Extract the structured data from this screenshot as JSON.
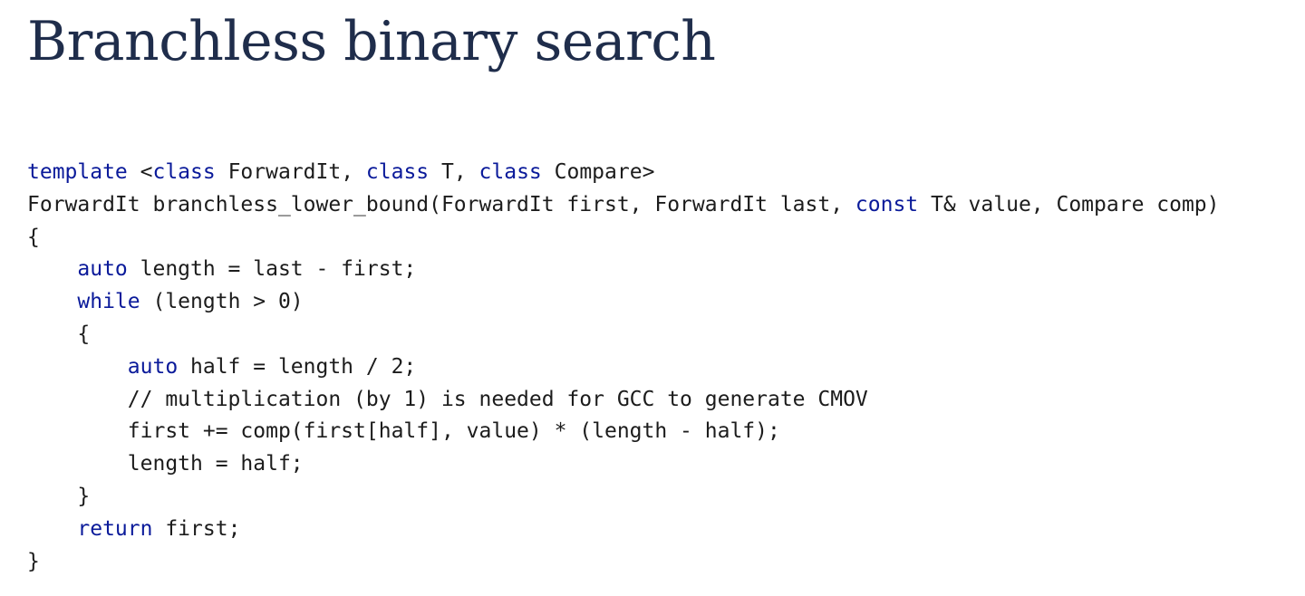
{
  "page": {
    "title": "Branchless binary search"
  },
  "code": {
    "language": "cpp",
    "lines": [
      [
        {
          "t": "kw",
          "v": "template"
        },
        {
          "t": "plain",
          "v": " <"
        },
        {
          "t": "kw",
          "v": "class"
        },
        {
          "t": "plain",
          "v": " ForwardIt, "
        },
        {
          "t": "kw",
          "v": "class"
        },
        {
          "t": "plain",
          "v": " T, "
        },
        {
          "t": "kw",
          "v": "class"
        },
        {
          "t": "plain",
          "v": " Compare>"
        }
      ],
      [
        {
          "t": "plain",
          "v": "ForwardIt branchless_lower_bound(ForwardIt first, ForwardIt last, "
        },
        {
          "t": "kw",
          "v": "const"
        },
        {
          "t": "plain",
          "v": " T& value, Compare comp)"
        }
      ],
      [
        {
          "t": "plain",
          "v": "{"
        }
      ],
      [
        {
          "t": "plain",
          "v": "    "
        },
        {
          "t": "kw",
          "v": "auto"
        },
        {
          "t": "plain",
          "v": " length = last - first;"
        }
      ],
      [
        {
          "t": "plain",
          "v": "    "
        },
        {
          "t": "kw",
          "v": "while"
        },
        {
          "t": "plain",
          "v": " (length > 0)"
        }
      ],
      [
        {
          "t": "plain",
          "v": "    {"
        }
      ],
      [
        {
          "t": "plain",
          "v": "        "
        },
        {
          "t": "kw",
          "v": "auto"
        },
        {
          "t": "plain",
          "v": " half = length / 2;"
        }
      ],
      [
        {
          "t": "plain",
          "v": "        // multiplication (by 1) is needed for GCC to generate CMOV"
        }
      ],
      [
        {
          "t": "plain",
          "v": "        first += comp(first[half], value) * (length - half);"
        }
      ],
      [
        {
          "t": "plain",
          "v": "        length = half;"
        }
      ],
      [
        {
          "t": "plain",
          "v": "    }"
        }
      ],
      [
        {
          "t": "plain",
          "v": "    "
        },
        {
          "t": "kw",
          "v": "return"
        },
        {
          "t": "plain",
          "v": " first;"
        }
      ],
      [
        {
          "t": "plain",
          "v": "}"
        }
      ]
    ],
    "colors": {
      "keyword": "#0a1a9a",
      "plain": "#1c1c1c",
      "heading": "#1f2d4b"
    }
  }
}
